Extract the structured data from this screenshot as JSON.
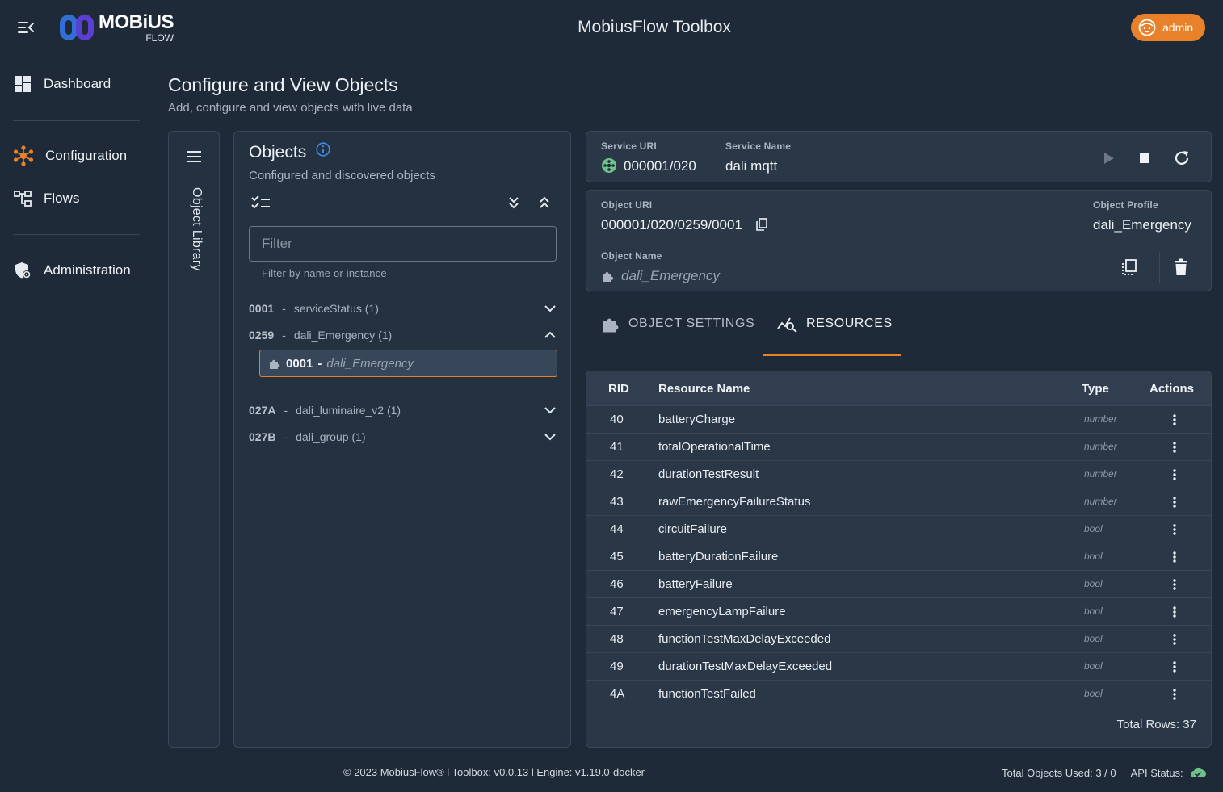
{
  "header": {
    "logo_main": "MOBiUS",
    "logo_sub": "FLOW",
    "app_title": "MobiusFlow Toolbox",
    "user_label": "admin"
  },
  "sidebar": {
    "items": [
      {
        "label": "Dashboard",
        "icon": "dashboard-icon"
      },
      {
        "label": "Configuration",
        "icon": "configuration-icon"
      },
      {
        "label": "Flows",
        "icon": "flows-icon"
      },
      {
        "label": "Administration",
        "icon": "administration-icon"
      }
    ]
  },
  "page": {
    "title": "Configure and View Objects",
    "subtitle": "Add, configure and view objects with live data"
  },
  "library": {
    "label": "Object Library"
  },
  "objects": {
    "title": "Objects",
    "subtitle": "Configured and discovered objects",
    "filter_placeholder": "Filter",
    "filter_help": "Filter by name or instance",
    "groups": [
      {
        "id": "0001",
        "name": "serviceStatus (1)",
        "expanded": false
      },
      {
        "id": "0259",
        "name": "dali_Emergency (1)",
        "expanded": true
      },
      {
        "id": "027A",
        "name": "dali_luminaire_v2 (1)",
        "expanded": false
      },
      {
        "id": "027B",
        "name": "dali_group (1)",
        "expanded": false
      }
    ],
    "selected_child": {
      "id": "0001",
      "sep": "-",
      "name": "dali_Emergency"
    }
  },
  "service": {
    "uri_label": "Service URI",
    "uri": "000001/020",
    "name_label": "Service Name",
    "name": "dali mqtt"
  },
  "object": {
    "uri_label": "Object URI",
    "uri": "000001/020/0259/0001",
    "profile_label": "Object Profile",
    "profile": "dali_Emergency",
    "name_label": "Object Name",
    "name": "dali_Emergency"
  },
  "tabs": [
    {
      "label": "OBJECT SETTINGS",
      "active": false
    },
    {
      "label": "RESOURCES",
      "active": true
    }
  ],
  "resources": {
    "columns": [
      "RID",
      "Resource Name",
      "Type",
      "Actions"
    ],
    "rows": [
      {
        "rid": "40",
        "name": "batteryCharge",
        "type": "number"
      },
      {
        "rid": "41",
        "name": "totalOperationalTime",
        "type": "number"
      },
      {
        "rid": "42",
        "name": "durationTestResult",
        "type": "number"
      },
      {
        "rid": "43",
        "name": "rawEmergencyFailureStatus",
        "type": "number"
      },
      {
        "rid": "44",
        "name": "circuitFailure",
        "type": "bool"
      },
      {
        "rid": "45",
        "name": "batteryDurationFailure",
        "type": "bool"
      },
      {
        "rid": "46",
        "name": "batteryFailure",
        "type": "bool"
      },
      {
        "rid": "47",
        "name": "emergencyLampFailure",
        "type": "bool"
      },
      {
        "rid": "48",
        "name": "functionTestMaxDelayExceeded",
        "type": "bool"
      },
      {
        "rid": "49",
        "name": "durationTestMaxDelayExceeded",
        "type": "bool"
      },
      {
        "rid": "4A",
        "name": "functionTestFailed",
        "type": "bool"
      }
    ],
    "total_rows": "Total Rows: 37"
  },
  "footer": {
    "copyright": "© 2023 MobiusFlow® l Toolbox: v0.0.13 l Engine: v1.19.0-docker",
    "objects_used": "Total Objects Used: 3 / 0",
    "api_status_label": "API Status:",
    "api_status": "ok"
  },
  "colors": {
    "background": "#1f2a38",
    "accent": "#e8812a",
    "status_ok": "#6dc28b"
  }
}
